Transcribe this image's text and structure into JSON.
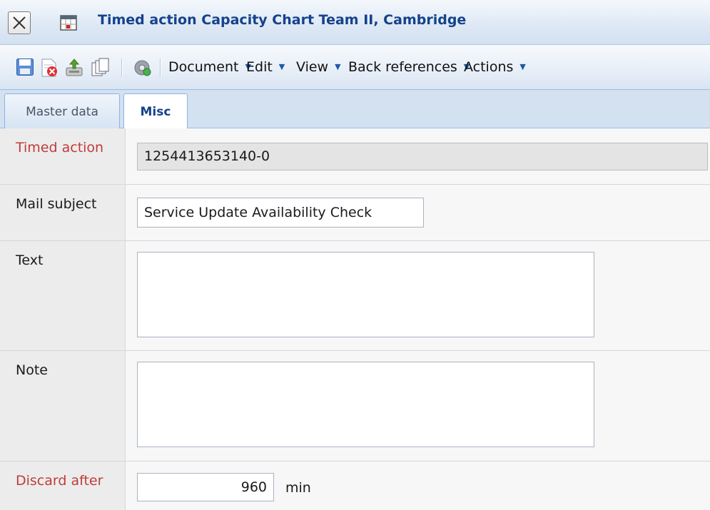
{
  "window": {
    "title": "Timed action Capacity Chart Team II, Cambridge"
  },
  "toolbar": {
    "icons": [
      "save-icon",
      "delete-icon",
      "export-icon",
      "copy-icon",
      "settings-icon"
    ],
    "menus": {
      "document": "Document",
      "edit": "Edit",
      "view": "View",
      "back_references": "Back references",
      "actions": "Actions"
    },
    "menu_arrow": "▼"
  },
  "tabs": {
    "master_data": "Master data",
    "misc": "Misc",
    "active": "Misc"
  },
  "form": {
    "timed_action": {
      "label": "Timed action",
      "value": "1254413653140-0",
      "required": true,
      "readonly": true
    },
    "mail_subject": {
      "label": "Mail subject",
      "value": "Service Update Availability Check"
    },
    "text": {
      "label": "Text",
      "value": ""
    },
    "note": {
      "label": "Note",
      "value": ""
    },
    "discard_after": {
      "label": "Discard after",
      "value": "960",
      "unit": "min",
      "required": true
    }
  },
  "colors": {
    "title": "#15428b",
    "required_label": "#c23b3b",
    "toolbar_arrow": "#1e5aa8"
  }
}
